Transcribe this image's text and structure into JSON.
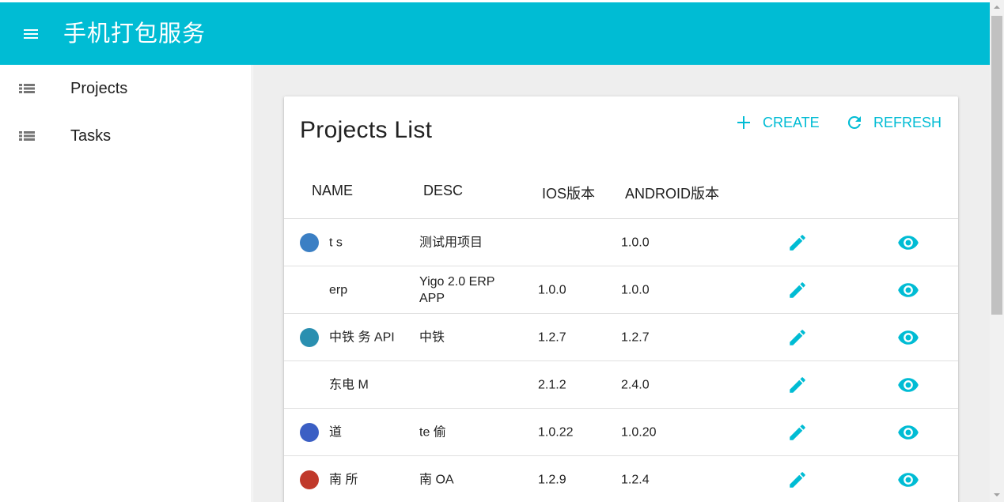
{
  "app": {
    "title": "手机打包服务",
    "accent_color": "#00bcd4"
  },
  "sidebar": {
    "items": [
      {
        "label": "Projects",
        "icon": "list-icon"
      },
      {
        "label": "Tasks",
        "icon": "list-icon"
      }
    ]
  },
  "card": {
    "title": "Projects List",
    "create_label": "CREATE",
    "refresh_label": "REFRESH"
  },
  "table": {
    "columns": [
      "NAME",
      "DESC",
      "IOS版本",
      "ANDROID版本"
    ],
    "rows": [
      {
        "name": "t s",
        "desc": "测试用项目",
        "ios": "",
        "android": "1.0.0",
        "thumb_color": "#3b7fc4"
      },
      {
        "name": "erp",
        "desc": "Yigo 2.0 ERP APP",
        "ios": "1.0.0",
        "android": "1.0.0",
        "thumb_color": "#ffffff"
      },
      {
        "name": "中铁 务 API",
        "desc": "中铁",
        "ios": "1.2.7",
        "android": "1.2.7",
        "thumb_color": "#2a8fb0"
      },
      {
        "name": "东电 M",
        "desc": "",
        "ios": "2.1.2",
        "android": "2.4.0",
        "thumb_color": "#ffffff"
      },
      {
        "name": "道",
        "desc": "te 偷",
        "ios": "1.0.22",
        "android": "1.0.20",
        "thumb_color": "#3b5fc4"
      },
      {
        "name": "南 所",
        "desc": "南 OA",
        "ios": "1.2.9",
        "android": "1.2.4",
        "thumb_color": "#c0392b"
      }
    ]
  }
}
